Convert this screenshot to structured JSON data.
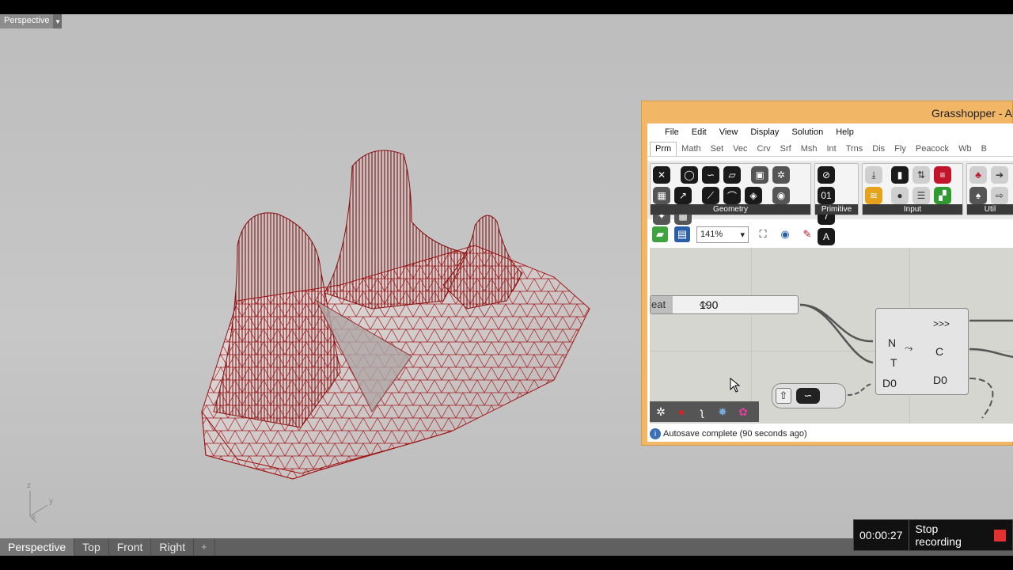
{
  "viewport": {
    "label": "Perspective",
    "axes": {
      "z": "z",
      "y": "y",
      "x": "x"
    },
    "tabs": [
      "Perspective",
      "Top",
      "Front",
      "Right"
    ],
    "add_tab": "+",
    "mesh_color": "#a01414"
  },
  "recording": {
    "time": "00:00:27",
    "stop_label": "Stop recording"
  },
  "grasshopper": {
    "title": "Grasshopper - Al",
    "menu": [
      "File",
      "Edit",
      "View",
      "Display",
      "Solution",
      "Help"
    ],
    "tabs": [
      "Prm",
      "Math",
      "Set",
      "Vec",
      "Crv",
      "Srf",
      "Msh",
      "Int",
      "Trns",
      "Dis",
      "Fly",
      "Peacock",
      "Wb",
      "B"
    ],
    "active_tab": "Prm",
    "panels": [
      {
        "label": "Geometry",
        "icons": [
          "point-param-icon",
          "circle-param-icon",
          "curve-param-icon",
          "surface-param-icon",
          "box-param-icon",
          "brep-param-icon",
          "mesh-param-icon",
          "vector-param-icon",
          "line-param-icon",
          "arc-param-icon",
          "plane-param-icon",
          "field-param-icon",
          "group-param-icon",
          "geometry-param-icon"
        ]
      },
      {
        "label": "Primitive",
        "icons": [
          "boolean-param-icon",
          "integer-param-icon",
          "number-param-icon",
          "text-param-icon"
        ]
      },
      {
        "label": "Input",
        "icons": [
          "data-input-icon",
          "toggle-icon",
          "slider-icon",
          "panel-icon",
          "graph-mapper-icon",
          "button-icon",
          "value-list-icon",
          "colour-swatch-icon"
        ]
      },
      {
        "label": "Util",
        "icons": [
          "cherry-icon",
          "arrow-right-icon",
          "tree-icon",
          "arrow-outline-icon"
        ]
      }
    ],
    "zoom": "141%",
    "slider": {
      "name": "eat",
      "value": "190"
    },
    "component": {
      "inputs": [
        "N",
        "T",
        "D0"
      ],
      "outputs": [
        ">>>",
        "C",
        "D0"
      ]
    },
    "status": "Autosave complete (90 seconds ago)"
  }
}
